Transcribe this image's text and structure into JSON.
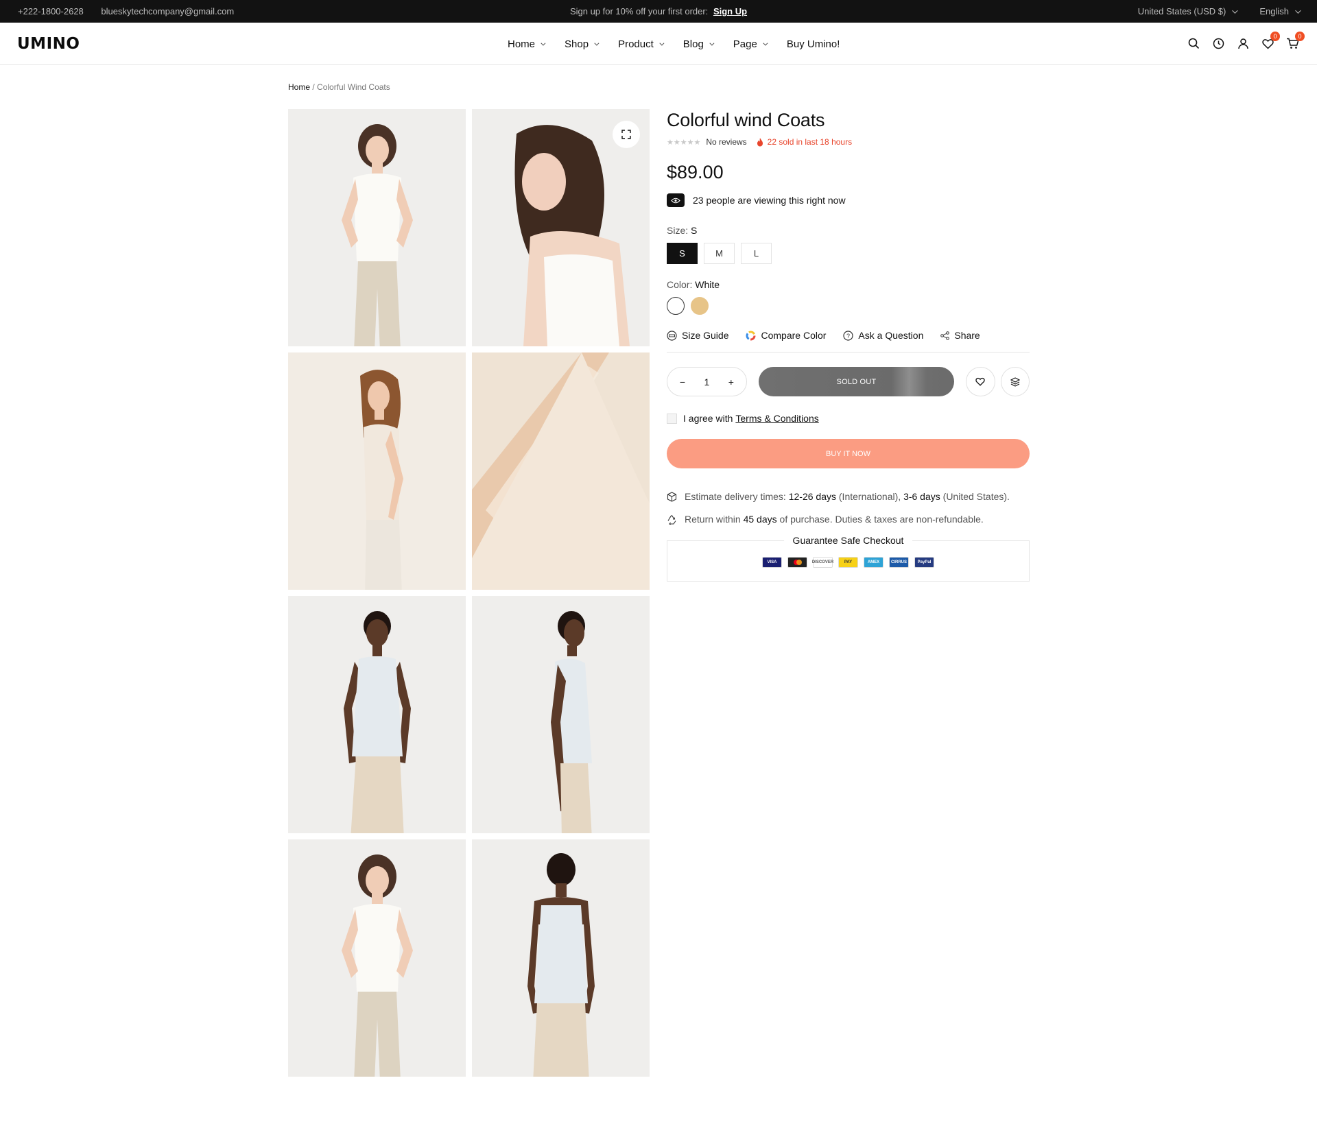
{
  "topbar": {
    "phone": "+222-1800-2628",
    "email": "blueskytechcompany@gmail.com",
    "promo_text": "Sign up for 10% off your first order:",
    "promo_link": "Sign Up",
    "currency": "United States (USD $)",
    "language": "English"
  },
  "header": {
    "logo": "UMINO",
    "nav": [
      {
        "label": "Home"
      },
      {
        "label": "Shop"
      },
      {
        "label": "Product"
      },
      {
        "label": "Blog"
      },
      {
        "label": "Page"
      },
      {
        "label": "Buy Umino!"
      }
    ],
    "wishlist_count": "0",
    "cart_count": "0"
  },
  "breadcrumb": {
    "home": "Home",
    "separator": "/",
    "current": "Colorful Wind Coats"
  },
  "product": {
    "title": "Colorful wind Coats",
    "reviews": "No reviews",
    "sold_text": "22 sold in last 18 hours",
    "price": "$89.00",
    "viewing_text": "23 people are viewing this right now",
    "size_label": "Size:",
    "size_selected": "S",
    "sizes": [
      "S",
      "M",
      "L"
    ],
    "color_label": "Color:",
    "color_selected": "White",
    "colors": [
      {
        "name": "White",
        "hex": "#ffffff"
      },
      {
        "name": "Beige",
        "hex": "#e7c488"
      }
    ],
    "tools": {
      "size_guide": "Size Guide",
      "compare_color": "Compare Color",
      "ask_question": "Ask a Question",
      "share": "Share"
    },
    "quantity": "1",
    "sold_out_label": "SOLD OUT",
    "agree_text": "I agree with",
    "terms_link": "Terms & Conditions",
    "buy_now_label": "BUY IT NOW",
    "delivery": {
      "prefix": "Estimate delivery times:",
      "intl_days": "12-26 days",
      "intl_label": "(International),",
      "us_days": "3-6 days",
      "us_label": "(United States)."
    },
    "returns": {
      "prefix": "Return within",
      "days": "45 days",
      "suffix": "of purchase. Duties & taxes are non-refundable."
    },
    "checkout_label": "Guarantee Safe Checkout",
    "payment_cards": [
      {
        "name": "VISA",
        "color": "#1a1f71"
      },
      {
        "name": "MC",
        "color": "#222222"
      },
      {
        "name": "DISCOVER",
        "color": "#ffffff"
      },
      {
        "name": "PAY",
        "color": "#f7d117"
      },
      {
        "name": "AMEX",
        "color": "#2ea3d6"
      },
      {
        "name": "CIRRUS",
        "color": "#1c5aa8"
      },
      {
        "name": "PayPal",
        "color": "#253b80"
      }
    ]
  },
  "colors": {
    "accent": "#fb9c82",
    "sold_alert": "#e8452c",
    "badge": "#f04e23",
    "topbar_bg": "#121212"
  }
}
